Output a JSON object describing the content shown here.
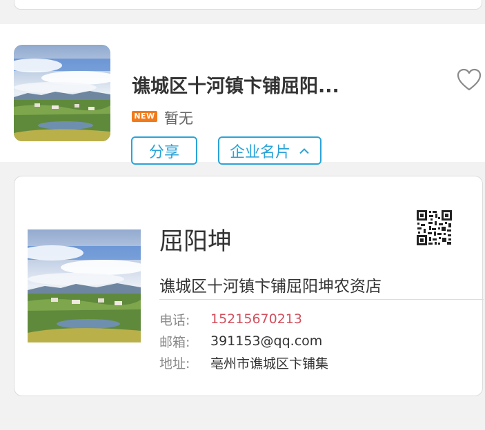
{
  "listing": {
    "title": "谯城区十河镇卞铺屈阳...",
    "badge": "NEW",
    "status": "暂无",
    "share_label": "分享",
    "business_card_label": "企业名片"
  },
  "business_card": {
    "name": "屈阳坤",
    "company": "谯城区十河镇卞铺屈阳坤农资店",
    "phone_label": "电话:",
    "phone": "15215670213",
    "email_label": "邮箱:",
    "email": "391153@qq.com",
    "address_label": "地址:",
    "address": "亳州市谯城区卞铺集"
  },
  "colors": {
    "accent_blue": "#2aa3d8",
    "badge_orange": "#f07b1c",
    "phone_red": "#d0505e"
  },
  "icons": {
    "favorite": "heart-outline-icon",
    "expand": "chevron-up-icon",
    "qr": "qr-code-icon"
  }
}
